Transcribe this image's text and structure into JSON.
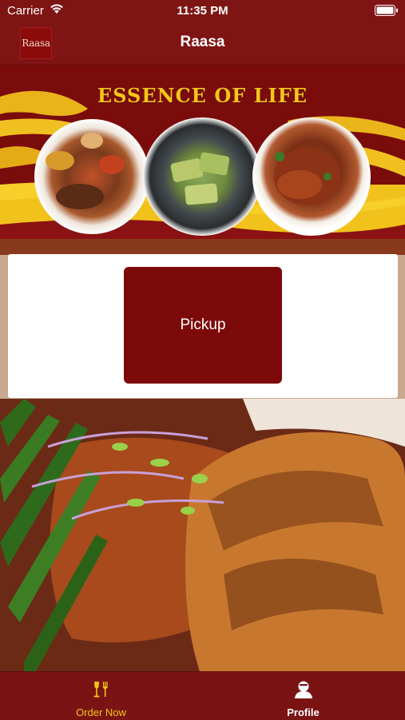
{
  "status_bar": {
    "carrier": "Carrier",
    "time": "11:35 PM"
  },
  "nav": {
    "logo_text": "Raasa",
    "title": "Raasa"
  },
  "banner": {
    "title": "ESSENCE OF LIFE"
  },
  "order": {
    "pickup_label": "Pickup"
  },
  "tab_bar": {
    "items": [
      {
        "label": "Order Now",
        "icon": "utensils-icon",
        "active": true
      },
      {
        "label": "Profile",
        "icon": "person-icon",
        "active": false
      }
    ]
  },
  "colors": {
    "brand": "#7d0a0a",
    "accent": "#f5c518",
    "card": "#ffffff"
  }
}
